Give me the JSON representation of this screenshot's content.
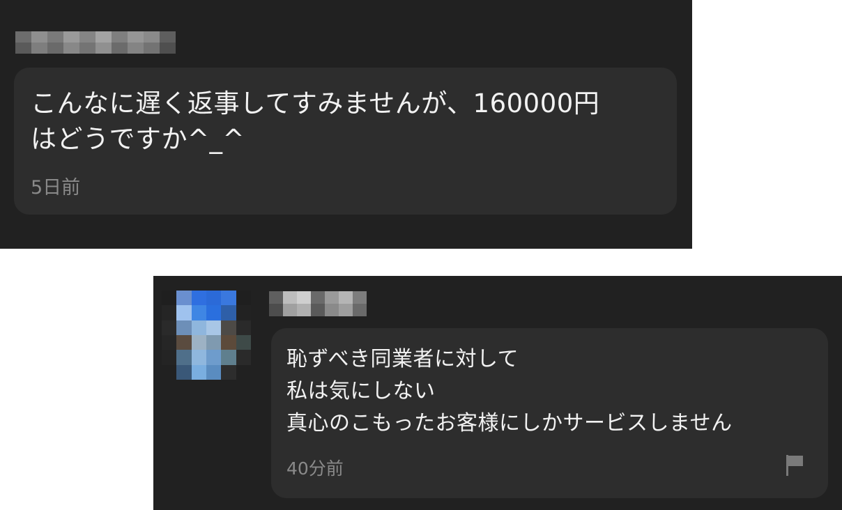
{
  "messages": [
    {
      "text": "こんなに遅く返事してすみませんが、160000円\nはどうですか^_^",
      "time": "5日前"
    },
    {
      "text": "恥ずべき同業者に対して\n私は気にしない\n真心のこもったお客様にしかサービスしません",
      "time": "40分前",
      "flag_icon": "flag-icon"
    }
  ],
  "colors": {
    "panel_background": "#212121",
    "bubble_background": "#2d2d2d",
    "message_text": "#f2f2f2",
    "timestamp_text": "#8a8a8a"
  }
}
